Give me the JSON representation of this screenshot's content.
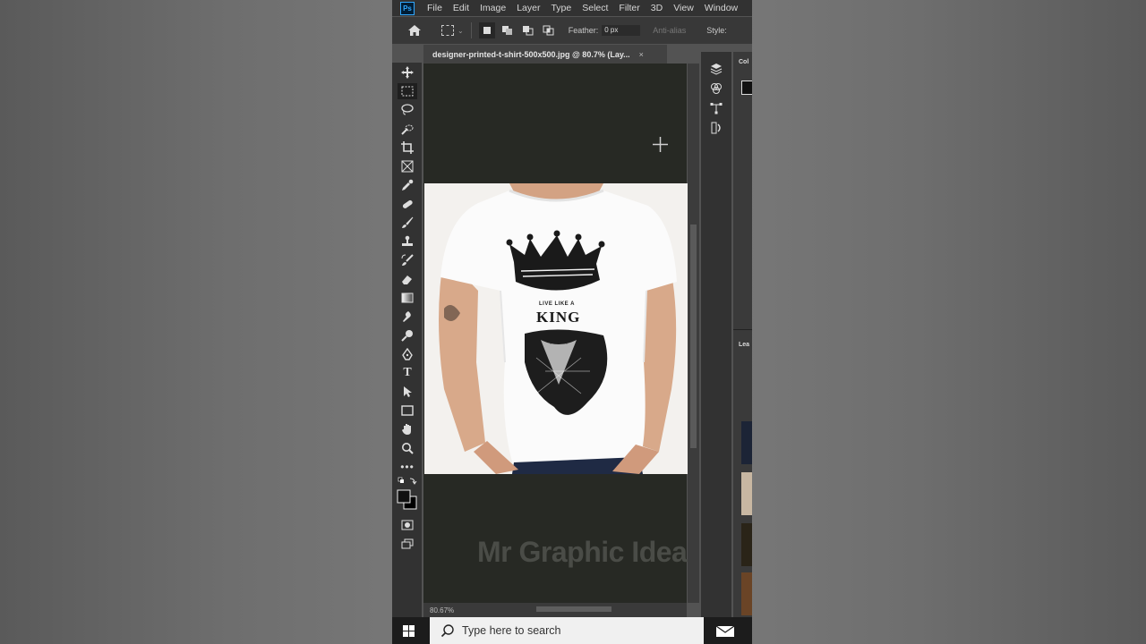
{
  "app": {
    "logo_text": "Ps",
    "menu": [
      "File",
      "Edit",
      "Image",
      "Layer",
      "Type",
      "Select",
      "Filter",
      "3D",
      "View",
      "Window"
    ]
  },
  "options": {
    "feather_label": "Feather:",
    "feather_value": "0 px",
    "anti_alias_label": "Anti-alias",
    "style_label": "Style:"
  },
  "document": {
    "tab_title": "designer-printed-t-shirt-500x500.jpg @ 80.7% (Lay...",
    "close_symbol": "×",
    "zoom": "80.67%"
  },
  "artwork": {
    "shirt_small_text": "LIVE LIKE A",
    "shirt_big_text": "KING",
    "watermark": "Mr Graphic Idea"
  },
  "panels": {
    "color_label": "Col",
    "layers_label": "Lea"
  },
  "taskbar": {
    "search_placeholder": "Type here to search"
  },
  "colors": {
    "canvas_bg": "#272924",
    "ps_blue": "#31a8ff",
    "ui_dark": "#323232"
  }
}
